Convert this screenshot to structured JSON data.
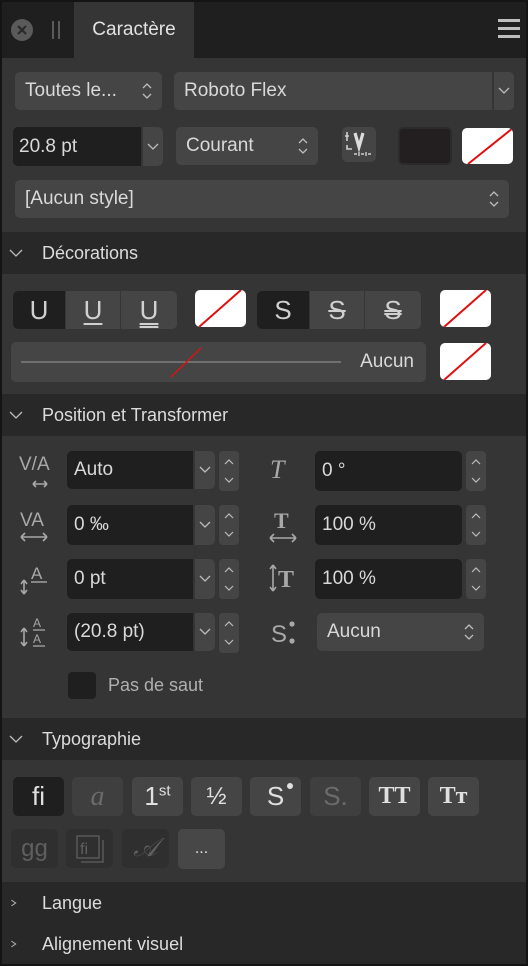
{
  "panel": {
    "title": "Caractère",
    "icons": {
      "close": "close-icon",
      "grip": "drag-handle-icon",
      "menu": "hamburger-menu-icon"
    }
  },
  "font": {
    "collection": "Toutes le...",
    "family": "Roboto Flex",
    "size": "20.8 pt",
    "weight": "Courant",
    "style": "[Aucun style]"
  },
  "decorations": {
    "title": "Décorations",
    "underline_options": [
      "U",
      "U",
      "U"
    ],
    "strike_options": [
      "S",
      "S",
      "S"
    ],
    "line_style_label": "Aucun"
  },
  "position": {
    "title": "Position et Transformer",
    "kerning": "Auto",
    "tracking": "0 ‰",
    "baseline": "0 pt",
    "leading": "(20.8 pt)",
    "skew": "0 °",
    "horizontal_scale": "100 %",
    "vertical_scale": "100 %",
    "script": "Aucun",
    "no_break_label": "Pas de saut",
    "no_break_checked": false
  },
  "typography": {
    "title": "Typographie",
    "buttons_row1": [
      "fi",
      "a",
      "1",
      "½",
      "S",
      "S.",
      "TT",
      "Tт"
    ],
    "ordinal_sup": "st",
    "more_label": "..."
  },
  "collapsed_sections": [
    "Langue",
    "Alignement visuel"
  ],
  "colors": {
    "no_color_line": "#e01010",
    "text_fill": "#231f20"
  }
}
